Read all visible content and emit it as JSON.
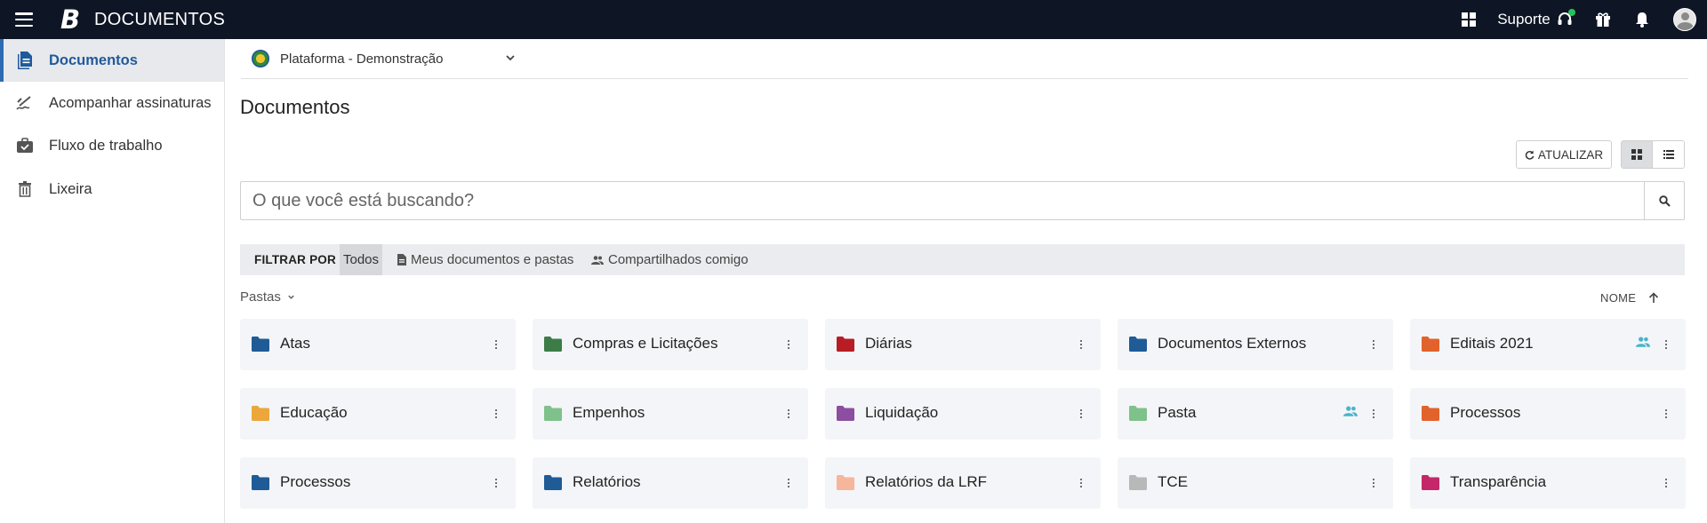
{
  "app": {
    "logo_letter": "B",
    "title": "DOCUMENTOS"
  },
  "topbar": {
    "suporte_label": "Suporte"
  },
  "sidebar": {
    "items": [
      {
        "label": "Documentos",
        "icon": "document-icon"
      },
      {
        "label": "Acompanhar assinaturas",
        "icon": "signature-icon"
      },
      {
        "label": "Fluxo de trabalho",
        "icon": "workflow-icon"
      },
      {
        "label": "Lixeira",
        "icon": "trash-icon"
      }
    ]
  },
  "platform": {
    "label": "Plataforma - Demonstração"
  },
  "page": {
    "title": "Documentos"
  },
  "toolbar": {
    "refresh_label": "ATUALIZAR"
  },
  "search": {
    "placeholder": "O que você está buscando?"
  },
  "filter": {
    "label": "FILTRAR POR",
    "options": [
      "Todos",
      "Meus documentos e pastas",
      "Compartilhados comigo"
    ]
  },
  "pastas": {
    "label": "Pastas"
  },
  "sort": {
    "label": "NOME"
  },
  "colors": {
    "topbar": "#0e1525",
    "accent": "#2c6bb3",
    "card_bg": "#f4f5f8",
    "shared_icon": "#4ab3c9"
  },
  "folders": [
    {
      "name": "Atas",
      "color": "#1f5b96",
      "shared": false
    },
    {
      "name": "Compras e Licitações",
      "color": "#3c7d47",
      "shared": false
    },
    {
      "name": "Diárias",
      "color": "#b81c24",
      "shared": false
    },
    {
      "name": "Documentos Externos",
      "color": "#1f5b96",
      "shared": false
    },
    {
      "name": "Editais 2021",
      "color": "#e2622b",
      "shared": true
    },
    {
      "name": "Educação",
      "color": "#eba73a",
      "shared": false
    },
    {
      "name": "Empenhos",
      "color": "#7ec18a",
      "shared": false
    },
    {
      "name": "Liquidação",
      "color": "#8b4ea0",
      "shared": false
    },
    {
      "name": "Pasta",
      "color": "#7ec18a",
      "shared": true
    },
    {
      "name": "Processos",
      "color": "#e2622b",
      "shared": false
    },
    {
      "name": "Processos",
      "color": "#1f5b96",
      "shared": false
    },
    {
      "name": "Relatórios",
      "color": "#1f5b96",
      "shared": false
    },
    {
      "name": "Relatórios da LRF",
      "color": "#f6b69b",
      "shared": false
    },
    {
      "name": "TCE",
      "color": "#b8b8b8",
      "shared": false
    },
    {
      "name": "Transparência",
      "color": "#c4286a",
      "shared": false
    }
  ]
}
